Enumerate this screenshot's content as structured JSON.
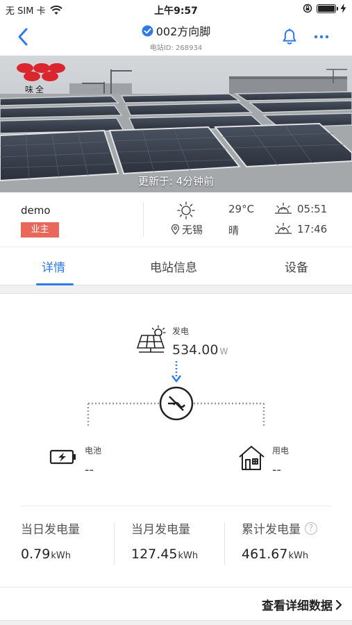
{
  "status_bar": {
    "carrier": "无 SIM 卡",
    "time": "上午9:57"
  },
  "nav": {
    "title": "002方向脚",
    "station_id": "电站ID: 268934",
    "icons": [
      "back-icon",
      "verified-icon",
      "bell-icon",
      "more-icon"
    ],
    "accent_color": "#2f7ae5"
  },
  "banner": {
    "logo_text": "味全",
    "update_text": "更新于: 4分钟前"
  },
  "info": {
    "owner_name": "demo",
    "owner_role": "业主",
    "location": "无锡",
    "temperature": "29°C",
    "weather": "晴",
    "sunrise": "05:51",
    "sunset": "17:46",
    "badge_color": "#e8695c"
  },
  "tabs": [
    {
      "label": "详情",
      "active": true
    },
    {
      "label": "电站信息",
      "active": false
    },
    {
      "label": "设备",
      "active": false
    }
  ],
  "flow": {
    "generation_label": "发电",
    "generation_value": "534.00",
    "generation_unit": "W",
    "battery_label": "电池",
    "battery_value": "--",
    "consumption_label": "用电",
    "consumption_value": "--"
  },
  "stats": [
    {
      "label": "当日发电量",
      "value": "0.79",
      "unit": "kWh"
    },
    {
      "label": "当月发电量",
      "value": "127.45",
      "unit": "kWh"
    },
    {
      "label": "累计发电量",
      "value": "461.67",
      "unit": "kWh",
      "help": "?"
    }
  ],
  "detail_link": "查看详细数据"
}
